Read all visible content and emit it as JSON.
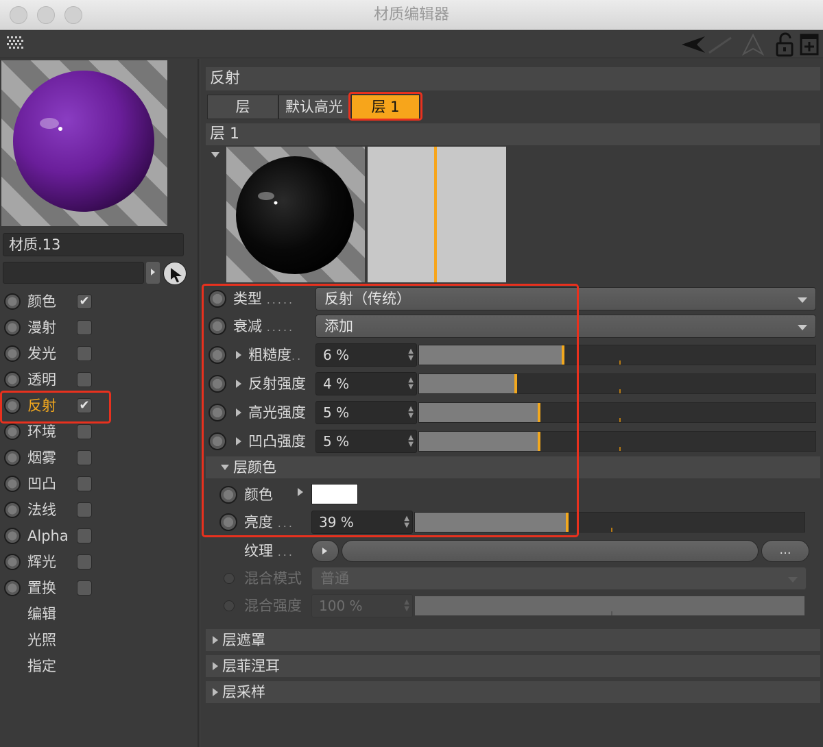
{
  "window": {
    "title": "材质编辑器"
  },
  "material": {
    "name": "材质.13"
  },
  "channels": [
    {
      "label": "颜色",
      "checked": true
    },
    {
      "label": "漫射",
      "checked": false
    },
    {
      "label": "发光",
      "checked": false
    },
    {
      "label": "透明",
      "checked": false
    },
    {
      "label": "反射",
      "checked": true,
      "active": true
    },
    {
      "label": "环境",
      "checked": false
    },
    {
      "label": "烟雾",
      "checked": false
    },
    {
      "label": "凹凸",
      "checked": false
    },
    {
      "label": "法线",
      "checked": false
    },
    {
      "label": "Alpha",
      "checked": false
    },
    {
      "label": "辉光",
      "checked": false
    },
    {
      "label": "置换",
      "checked": false
    }
  ],
  "extra_items": [
    "编辑",
    "光照",
    "指定"
  ],
  "reflection": {
    "header": "反射",
    "tabs": [
      {
        "label": "层"
      },
      {
        "label": "默认高光"
      },
      {
        "label": "层 1",
        "active": true
      }
    ],
    "layer_title": "层 1",
    "type": {
      "label": "类型",
      "dots": ".....",
      "value": "反射（传统）"
    },
    "falloff": {
      "label": "衰减",
      "dots": ".....",
      "value": "添加"
    },
    "params": [
      {
        "label": "粗糙度",
        "suffix": "..",
        "value": "6 %",
        "level": 0.06
      },
      {
        "label": "反射强度",
        "suffix": "",
        "value": "4 %",
        "level": 0.04
      },
      {
        "label": "高光强度",
        "suffix": "",
        "value": "5 %",
        "level": 0.05
      },
      {
        "label": "凹凸强度",
        "suffix": "",
        "value": "5 %",
        "level": 0.05
      }
    ],
    "layer_color": {
      "header": "层颜色",
      "color_label": "颜色",
      "color_value": "#ffffff",
      "brightness_label": "亮度",
      "brightness_dots": "...",
      "brightness_value": "39 %",
      "brightness_level": 0.39,
      "texture_label": "纹理",
      "texture_dots": "...",
      "texture_more": "...",
      "blend_mode_label": "混合模式",
      "blend_mode_value": "普通",
      "blend_strength_label": "混合强度",
      "blend_strength_value": "100 %",
      "blend_strength_level": 1.0
    },
    "sections": [
      "层遮罩",
      "层菲涅耳",
      "层采样"
    ]
  },
  "colors": {
    "accent": "#f2a81e",
    "highlight": "#e8311e",
    "sphere": "#6a1e9a"
  }
}
